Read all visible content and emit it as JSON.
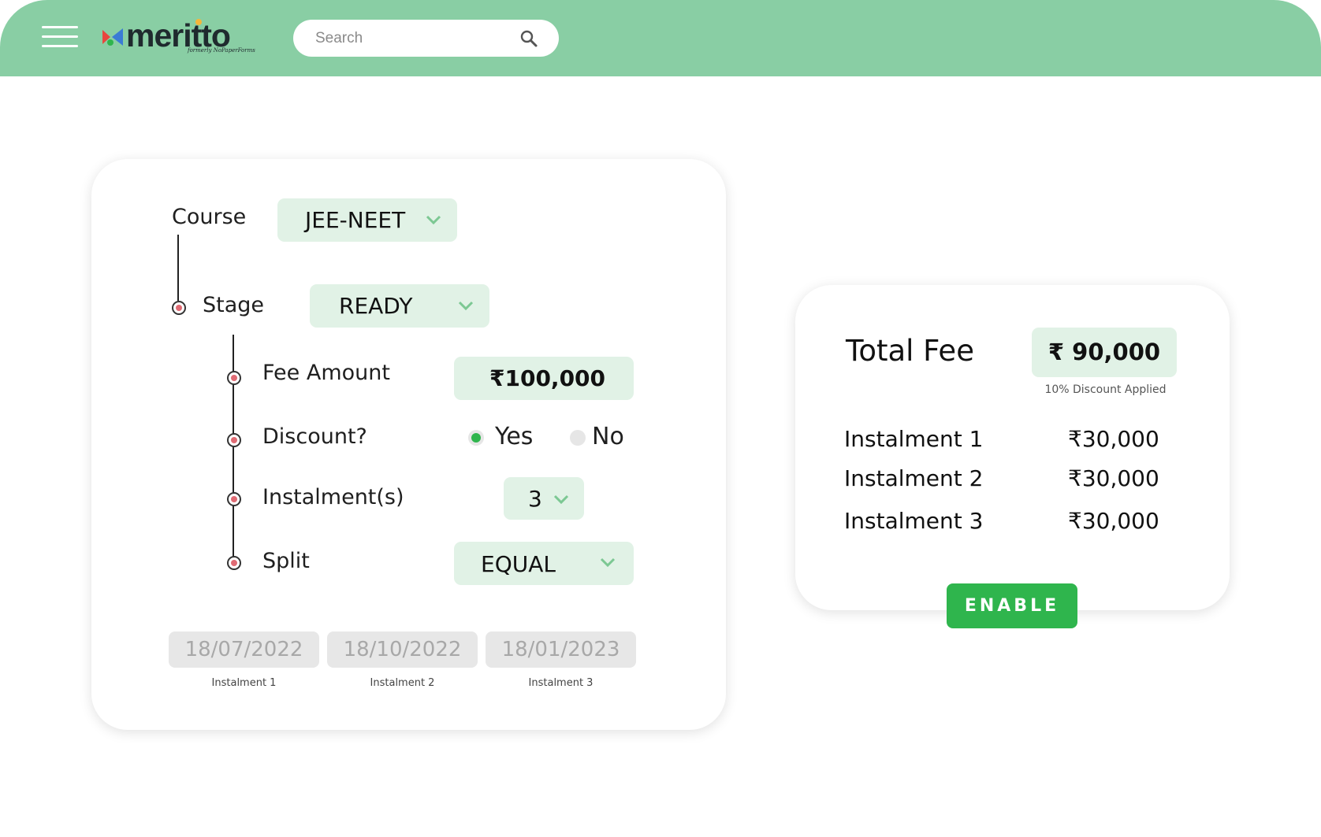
{
  "header": {
    "logo_text": "meritto",
    "logo_subtext": "formerly NoPaperForms",
    "search_placeholder": "Search"
  },
  "form": {
    "course_label": "Course",
    "course_value": "JEE-NEET",
    "stage_label": "Stage",
    "stage_value": "READY",
    "fee_label": "Fee Amount",
    "fee_value": "₹100,000",
    "discount_label": "Discount?",
    "discount_yes": "Yes",
    "discount_no": "No",
    "discount_selected": "Yes",
    "instalments_label": "Instalment(s)",
    "instalments_value": "3",
    "split_label": "Split",
    "split_value": "EQUAL",
    "dates": [
      {
        "date": "18/07/2022",
        "caption": "Instalment 1"
      },
      {
        "date": "18/10/2022",
        "caption": "Instalment 2"
      },
      {
        "date": "18/01/2023",
        "caption": "Instalment 3"
      }
    ]
  },
  "summary": {
    "total_label": "Total Fee",
    "total_value": "₹ 90,000",
    "discount_note": "10% Discount Applied",
    "instalments": [
      {
        "label": "Instalment 1",
        "amount": "₹30,000"
      },
      {
        "label": "Instalment 2",
        "amount": "₹30,000"
      },
      {
        "label": "Instalment 3",
        "amount": "₹30,000"
      }
    ],
    "enable_label": "ENABLE"
  },
  "colors": {
    "header_bg": "#89cea4",
    "dropdown_bg": "#e1f2e6",
    "accent_green": "#2fb54d",
    "node_red": "#e06b74"
  }
}
